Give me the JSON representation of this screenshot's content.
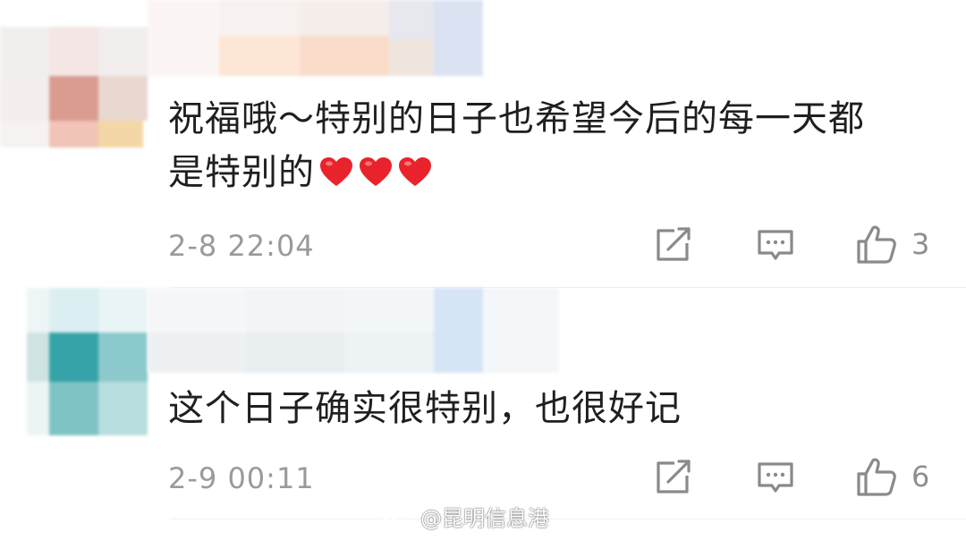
{
  "comments": [
    {
      "text_line1": "祝福哦～特别的日子也希望今后的每一天都",
      "text_line2": "是特别的",
      "emoji": [
        "heart",
        "heart",
        "heart"
      ],
      "time": "2-8 22:04",
      "likes": "3",
      "icons": {
        "repost": "repost-icon",
        "reply": "comment-icon",
        "like": "thumbs-up-icon"
      }
    },
    {
      "text_line1": "这个日子确实很特别，也很好记",
      "time": "2-9 00:11",
      "likes": "6",
      "icons": {
        "repost": "repost-icon",
        "reply": "comment-icon",
        "like": "thumbs-up-icon"
      }
    }
  ],
  "watermark": {
    "text": "@昆明信息港",
    "icon": "weibo-logo"
  },
  "colors": {
    "text": "#1f1f1f",
    "meta": "#9a9a9a",
    "icon": "#8a8a8a",
    "heart": "#e8232b"
  }
}
